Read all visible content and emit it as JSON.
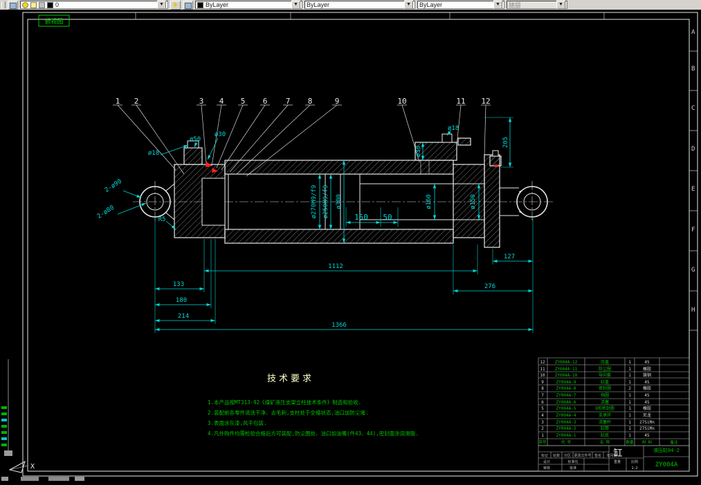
{
  "toolbar": {
    "layer_name": "0",
    "color": "ByLayer",
    "linetype": "ByLayer",
    "lineweight": "ByLayer",
    "plot_style": "随层"
  },
  "canvas": {
    "corner_label": "俯视图",
    "zone_letters": [
      "A",
      "B",
      "C",
      "D",
      "E",
      "F",
      "G",
      "H"
    ],
    "ucs_x": "X"
  },
  "callouts": [
    "1",
    "2",
    "3",
    "4",
    "5",
    "6",
    "7",
    "8",
    "9",
    "10",
    "11",
    "12"
  ],
  "dims": {
    "d18L": "ø18",
    "d50": "ø50",
    "d30L": "ø30",
    "d18R": "ø18",
    "d30R": "ø30",
    "v205": "205",
    "d270": "ø270H9/f9",
    "d250": "ø250H9/f9",
    "d300": "ø300",
    "d160": "ø160",
    "d150": "ø150",
    "l150": "150",
    "l50": "50",
    "l1112": "1112",
    "l133": "133",
    "l180": "180",
    "l214": "214",
    "l276": "276",
    "l127": "127",
    "l1366": "1366",
    "eye_outer": "2-ø90",
    "eye_hole": "2-ø80",
    "r5": "R5"
  },
  "tech": {
    "title": "技术要求",
    "lines": [
      "1.本产品按MT313-92《煤矿液压支架立柱技术条件》制造和验收.",
      "2.装配前各零件清洗干净、去毛刺,支柱处于全缩状态,油口加防尘堵.",
      "3.表面涂灰漆,风干包装.",
      "4.凡外购件均需检验合格后方可装配,防尘圈处、油口加油嘴(件43、44),密封面涂润滑脂."
    ]
  },
  "parts": {
    "header": {
      "no": "序号",
      "code": "代  号",
      "name": "名  称",
      "qty": "数量",
      "mat": "材  料",
      "remark": "备注"
    },
    "rows": [
      {
        "no": "12",
        "code": "ZY004A-12",
        "name": "压盖",
        "qty": "1",
        "mat": "45",
        "remark": ""
      },
      {
        "no": "11",
        "code": "ZY004A-11",
        "name": "防尘圈",
        "qty": "1",
        "mat": "橡胶",
        "remark": ""
      },
      {
        "no": "10",
        "code": "ZY004A-10",
        "name": "导向套",
        "qty": "1",
        "mat": "铸铜",
        "remark": ""
      },
      {
        "no": "9",
        "code": "ZY004A-9",
        "name": "缸盖",
        "qty": "1",
        "mat": "45",
        "remark": ""
      },
      {
        "no": "8",
        "code": "ZY004A-8",
        "name": "密封圈",
        "qty": "2",
        "mat": "橡胶",
        "remark": ""
      },
      {
        "no": "7",
        "code": "ZY004A-7",
        "name": "挡圈",
        "qty": "1",
        "mat": "45",
        "remark": ""
      },
      {
        "no": "6",
        "code": "ZY004A-6",
        "name": "活塞",
        "qty": "1",
        "mat": "45",
        "remark": ""
      },
      {
        "no": "5",
        "code": "ZY004A-5",
        "name": "O形密封圈",
        "qty": "1",
        "mat": "橡胶",
        "remark": ""
      },
      {
        "no": "4",
        "code": "ZY004A-4",
        "name": "支承环",
        "qty": "1",
        "mat": "尼龙",
        "remark": ""
      },
      {
        "no": "3",
        "code": "ZY004A-3",
        "name": "活塞杆",
        "qty": "1",
        "mat": "27SiMn",
        "remark": ""
      },
      {
        "no": "2",
        "code": "ZY004A-2",
        "name": "缸筒",
        "qty": "1",
        "mat": "27SiMn",
        "remark": ""
      },
      {
        "no": "1",
        "code": "ZY004A-1",
        "name": "缸底",
        "qty": "1",
        "mat": "45",
        "remark": ""
      }
    ]
  },
  "title_block": {
    "part_name": "缸",
    "drawing_no": "ZY004A",
    "project": "液压缸04-2",
    "scale_label": "比例",
    "scale": "1:2",
    "weight_label": "重量",
    "labels": {
      "mark": "标记",
      "count": "处数",
      "zone": "分区",
      "doc": "更改文件号",
      "sign": "签名",
      "date": "年月日",
      "design": "设计",
      "check": "审核",
      "std": "标准化",
      "approve": "批准"
    }
  }
}
